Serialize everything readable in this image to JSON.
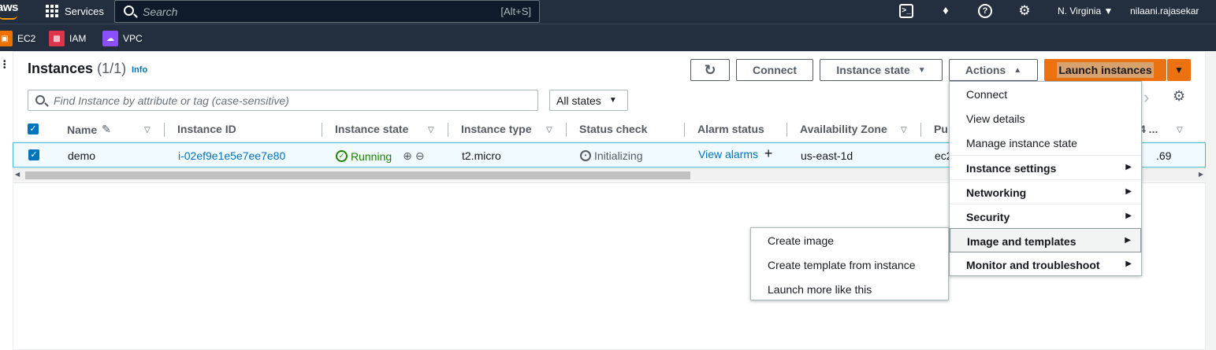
{
  "topnav": {
    "logo": "aws",
    "services": "Services",
    "search_placeholder": "Search",
    "search_shortcut": "[Alt+S]",
    "terminal_icon": ">_",
    "help_icon": "?",
    "region": "N. Virginia",
    "user": "nilaani.rajasekar"
  },
  "favorites": [
    {
      "label": "EC2",
      "color": "#ed7100"
    },
    {
      "label": "IAM",
      "color": "#dd344c"
    },
    {
      "label": "VPC",
      "color": "#8c4fff"
    }
  ],
  "page": {
    "title": "Instances",
    "count": "(1/1)",
    "info": "Info",
    "buttons": {
      "connect": "Connect",
      "instance_state": "Instance state",
      "actions": "Actions",
      "launch": "Launch instances"
    },
    "search_placeholder": "Find Instance by attribute or tag (case-sensitive)",
    "filter": "All states"
  },
  "table": {
    "columns": [
      "Name",
      "Instance ID",
      "Instance state",
      "Instance type",
      "Status check",
      "Alarm status",
      "Availability Zone",
      "Pu",
      "4 ..."
    ],
    "row": {
      "name": "demo",
      "instance_id": "i-02ef9e1e5e7ee7e80",
      "state": "Running",
      "type": "t2.micro",
      "status": "Initializing",
      "alarm": "View alarms",
      "az": "us-east-1d",
      "public": "ec2",
      "ip": ".69"
    }
  },
  "actions_menu": {
    "items": [
      {
        "label": "Connect",
        "bold": false,
        "submenu": false
      },
      {
        "label": "View details",
        "bold": false,
        "submenu": false
      },
      {
        "label": "Manage instance state",
        "bold": false,
        "submenu": false
      },
      {
        "label": "Instance settings",
        "bold": true,
        "submenu": true
      },
      {
        "label": "Networking",
        "bold": true,
        "submenu": true
      },
      {
        "label": "Security",
        "bold": true,
        "submenu": true
      },
      {
        "label": "Image and templates",
        "bold": true,
        "submenu": true
      },
      {
        "label": "Monitor and troubleshoot",
        "bold": true,
        "submenu": true
      }
    ]
  },
  "submenu": {
    "items": [
      "Create image",
      "Create template from instance",
      "Launch more like this"
    ]
  },
  "colors": {
    "nav_bg": "#232f3e",
    "primary": "#ec7211",
    "link": "#0073bb",
    "running": "#1d8102"
  }
}
